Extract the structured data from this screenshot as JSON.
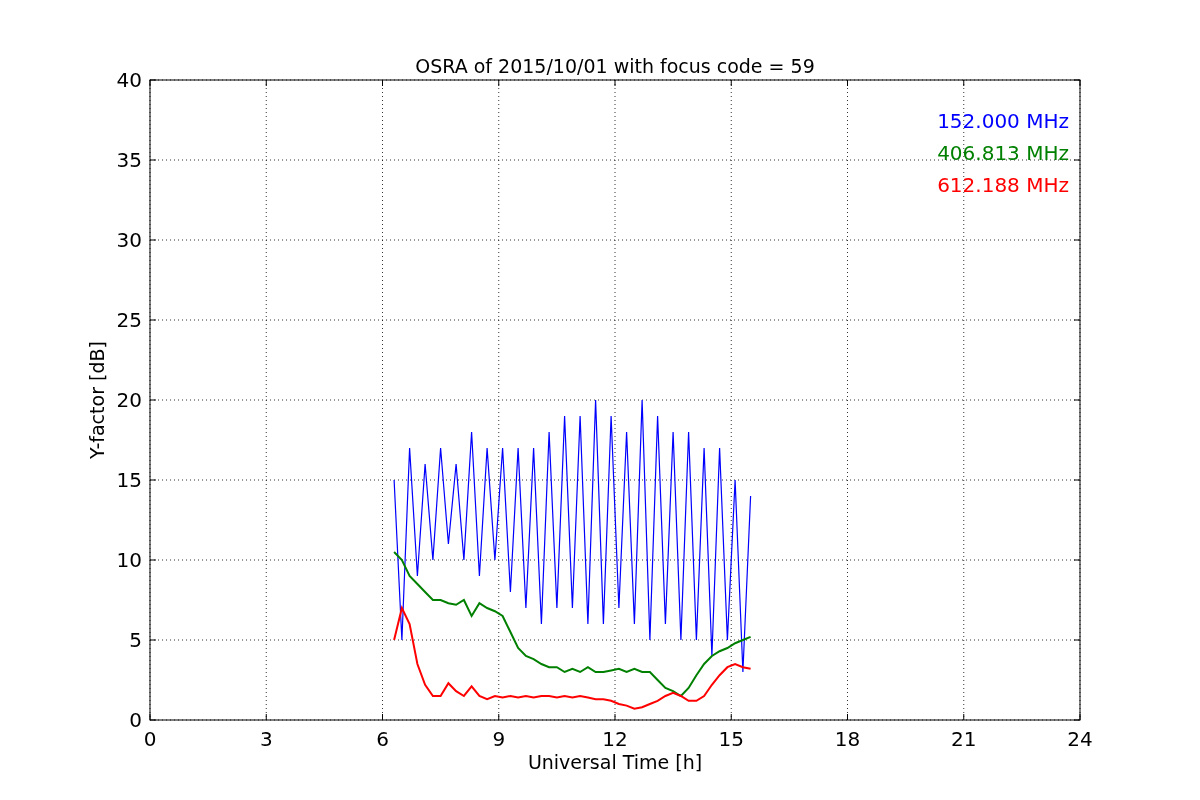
{
  "chart_data": {
    "type": "line",
    "title": "OSRA of 2015/10/01 with focus code = 59",
    "xlabel": "Universal Time [h]",
    "ylabel": "Y-factor [dB]",
    "x": [
      6.3,
      6.5,
      6.7,
      6.9,
      7.1,
      7.3,
      7.5,
      7.7,
      7.9,
      8.1,
      8.3,
      8.5,
      8.7,
      8.9,
      9.1,
      9.3,
      9.5,
      9.7,
      9.9,
      10.1,
      10.3,
      10.5,
      10.7,
      10.9,
      11.1,
      11.3,
      11.5,
      11.7,
      11.9,
      12.1,
      12.3,
      12.5,
      12.7,
      12.9,
      13.1,
      13.3,
      13.5,
      13.7,
      13.9,
      14.1,
      14.3,
      14.5,
      14.7,
      14.9,
      15.1,
      15.3,
      15.5
    ],
    "series": [
      {
        "name": "152.000 MHz",
        "color": "#0000ff",
        "values": [
          15,
          5,
          17,
          9,
          16,
          10,
          17,
          11,
          16,
          10,
          18,
          9,
          17,
          10,
          17,
          8,
          17,
          7,
          17,
          6,
          18,
          7,
          19,
          7,
          19,
          6,
          20,
          6,
          19,
          7,
          18,
          6,
          20,
          5,
          19,
          6,
          18,
          5,
          18,
          5,
          17,
          4,
          17,
          5,
          15,
          3,
          14
        ]
      },
      {
        "name": "406.813 MHz",
        "color": "#008000",
        "values": [
          10.5,
          10,
          9,
          8.5,
          8,
          7.5,
          7.5,
          7.3,
          7.2,
          7.5,
          6.5,
          7.3,
          7,
          6.8,
          6.5,
          5.5,
          4.5,
          4,
          3.8,
          3.5,
          3.3,
          3.3,
          3,
          3.2,
          3,
          3.3,
          3,
          3,
          3.1,
          3.2,
          3,
          3.2,
          3,
          3,
          2.5,
          2,
          1.8,
          1.5,
          2,
          2.8,
          3.5,
          4,
          4.3,
          4.5,
          4.8,
          5,
          5.2
        ]
      },
      {
        "name": "612.188 MHz",
        "color": "#ff0000",
        "values": [
          5,
          7,
          6,
          3.5,
          2.2,
          1.5,
          1.5,
          2.3,
          1.8,
          1.5,
          2.1,
          1.5,
          1.3,
          1.5,
          1.4,
          1.5,
          1.4,
          1.5,
          1.4,
          1.5,
          1.5,
          1.4,
          1.5,
          1.4,
          1.5,
          1.4,
          1.3,
          1.3,
          1.2,
          1.0,
          0.9,
          0.7,
          0.8,
          1.0,
          1.2,
          1.5,
          1.7,
          1.5,
          1.2,
          1.2,
          1.5,
          2.2,
          2.8,
          3.3,
          3.5,
          3.3,
          3.2
        ]
      }
    ],
    "grid": true,
    "xlim": [
      0,
      24
    ],
    "ylim": [
      0,
      40
    ],
    "xticks": [
      0,
      3,
      6,
      9,
      12,
      15,
      18,
      21,
      24
    ],
    "yticks": [
      0,
      5,
      10,
      15,
      20,
      25,
      30,
      35,
      40
    ]
  }
}
